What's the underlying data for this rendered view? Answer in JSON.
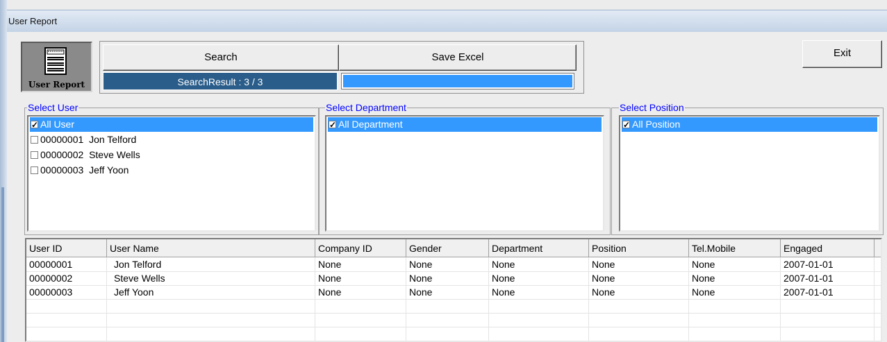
{
  "window": {
    "title": "User Report"
  },
  "toolbar": {
    "icon_label": "User Report",
    "search_label": "Search",
    "save_excel_label": "Save Excel",
    "search_result": "SearchResult : 3 / 3",
    "exit_label": "Exit"
  },
  "colors": {
    "selection": "#3399ff",
    "result_bar": "#2a5d8a",
    "progress_bar": "#3399ff",
    "legend": "#0000ff"
  },
  "select_user": {
    "legend": "Select User",
    "items": [
      {
        "label": "All User",
        "checked": true,
        "selected": true
      },
      {
        "label": "00000001  Jon Telford",
        "checked": false,
        "selected": false
      },
      {
        "label": "00000002  Steve Wells",
        "checked": false,
        "selected": false
      },
      {
        "label": "00000003  Jeff Yoon",
        "checked": false,
        "selected": false
      }
    ]
  },
  "select_department": {
    "legend": "Select Department",
    "items": [
      {
        "label": "All Department",
        "checked": true,
        "selected": true
      }
    ]
  },
  "select_position": {
    "legend": "Select Position",
    "items": [
      {
        "label": "All Position",
        "checked": true,
        "selected": true
      }
    ]
  },
  "table": {
    "columns": [
      "User ID",
      "User Name",
      "Company ID",
      "Gender",
      "Department",
      "Position",
      "Tel.Mobile",
      "Engaged"
    ],
    "rows": [
      [
        "00000001",
        "Jon Telford",
        "None",
        "None",
        "None",
        "None",
        "None",
        "2007-01-01"
      ],
      [
        "00000002",
        "Steve Wells",
        "None",
        "None",
        "None",
        "None",
        "None",
        "2007-01-01"
      ],
      [
        "00000003",
        "Jeff Yoon",
        "None",
        "None",
        "None",
        "None",
        "None",
        "2007-01-01"
      ]
    ]
  }
}
